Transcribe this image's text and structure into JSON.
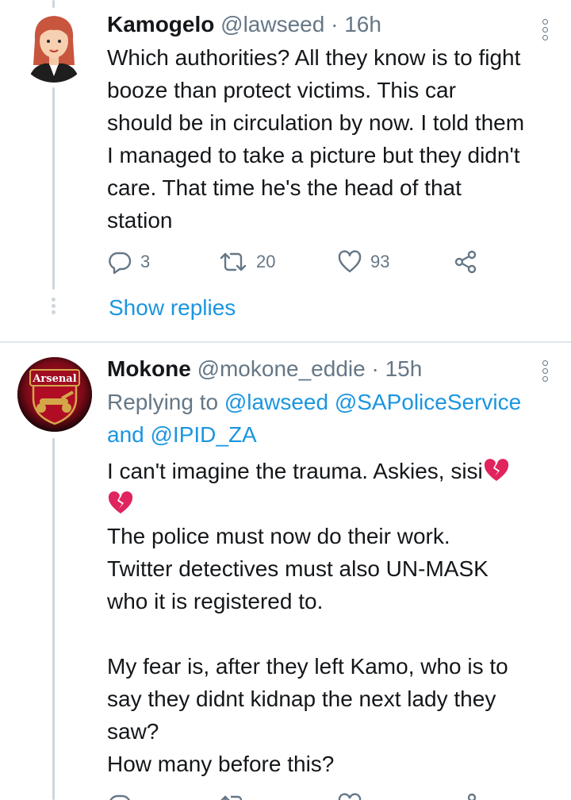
{
  "tweets": [
    {
      "name": "Kamogelo",
      "handle": "@lawseed",
      "sep": "·",
      "time": "16h",
      "lines": [
        "Which authorities? All they know is to fight",
        "booze than protect victims. This car",
        "should be in circulation by now. I told them",
        "I managed to take a picture but they didn't",
        "care. That time he's the head of that",
        "station"
      ],
      "replies": "3",
      "retweets": "20",
      "likes": "93",
      "show_replies": "Show replies"
    },
    {
      "name": "Mokone",
      "handle": "@mokone_eddie",
      "sep": "·",
      "time": "15h",
      "replying_prefix": "Replying to",
      "replying_mention_1": "@lawseed",
      "replying_mention_2": "@SAPoliceService",
      "replying_and": "and",
      "replying_mention_3": "@IPID_ZA",
      "line1": "I can't imagine the trauma. Askies, sisi",
      "lines": [
        "The police must now do their work.",
        "Twitter detectives must also UN-MASK",
        "who it is registered to.",
        "",
        "My fear is, after they left Kamo, who is to",
        "say they didnt kidnap the next lady they",
        "saw?",
        "How many before this?"
      ],
      "avatar_text": "Arsenal"
    }
  ],
  "colors": {
    "link": "#1b95e0",
    "secondary": "#657786",
    "thread": "#ccd6dd",
    "broken_heart": "#e0245e"
  },
  "icons": [
    "reply-icon",
    "retweet-icon",
    "like-icon",
    "share-icon",
    "more-icon",
    "broken-heart-emoji"
  ]
}
